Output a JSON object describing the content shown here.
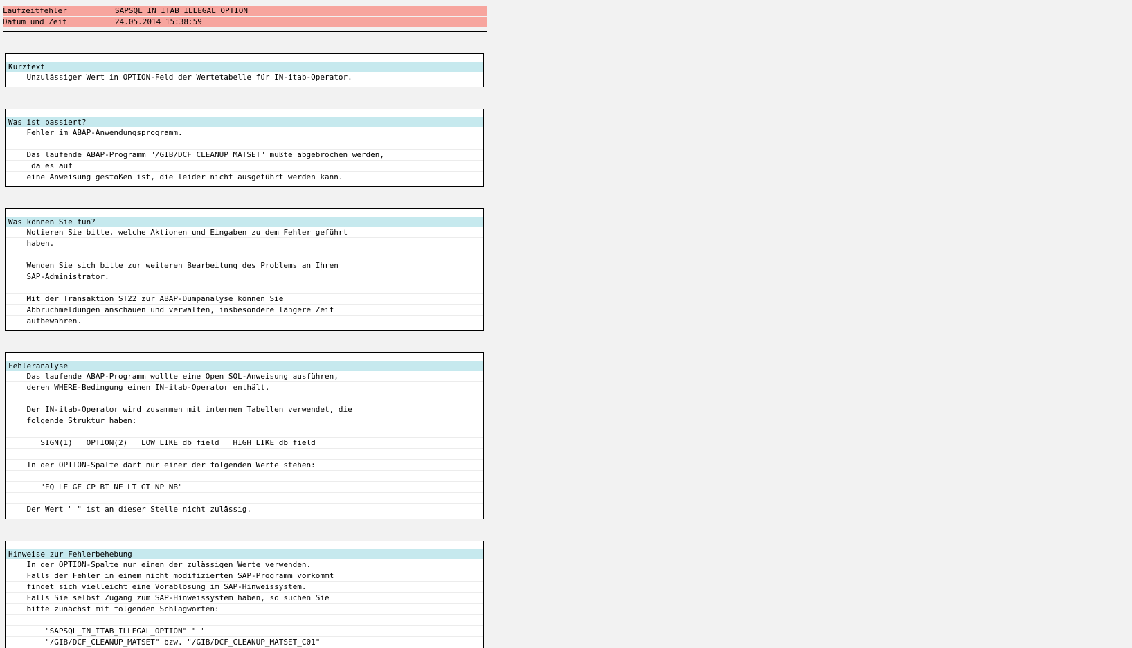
{
  "header": {
    "rows": [
      {
        "label": "Laufzeitfehler",
        "value": "SAPSQL_IN_ITAB_ILLEGAL_OPTION"
      },
      {
        "label": "Datum und Zeit",
        "value": "24.05.2014 15:38:59"
      }
    ]
  },
  "sections": [
    {
      "title": "Kurztext",
      "lines": [
        "    Unzulässiger Wert in OPTION-Feld der Wertetabelle für IN-itab-Operator."
      ]
    },
    {
      "title": "Was ist passiert?",
      "lines": [
        "    Fehler im ABAP-Anwendungsprogramm.",
        "",
        "    Das laufende ABAP-Programm \"/GIB/DCF_CLEANUP_MATSET\" mußte abgebrochen werden,",
        "     da es auf",
        "    eine Anweisung gestoßen ist, die leider nicht ausgeführt werden kann."
      ]
    },
    {
      "title": "Was können Sie tun?",
      "lines": [
        "    Notieren Sie bitte, welche Aktionen und Eingaben zu dem Fehler geführt",
        "    haben.",
        "",
        "    Wenden Sie sich bitte zur weiteren Bearbeitung des Problems an Ihren",
        "    SAP-Administrator.",
        "",
        "    Mit der Transaktion ST22 zur ABAP-Dumpanalyse können Sie",
        "    Abbruchmeldungen anschauen und verwalten, insbesondere längere Zeit",
        "    aufbewahren."
      ]
    },
    {
      "title": "Fehleranalyse",
      "lines": [
        "    Das laufende ABAP-Programm wollte eine Open SQL-Anweisung ausführen,",
        "    deren WHERE-Bedingung einen IN-itab-Operator enthält.",
        "",
        "    Der IN-itab-Operator wird zusammen mit internen Tabellen verwendet, die",
        "    folgende Struktur haben:",
        "",
        "       SIGN(1)   OPTION(2)   LOW LIKE db_field   HIGH LIKE db_field",
        "",
        "    In der OPTION-Spalte darf nur einer der folgenden Werte stehen:",
        "",
        "       \"EQ LE GE CP BT NE LT GT NP NB\"",
        "",
        "    Der Wert \" \" ist an dieser Stelle nicht zulässig."
      ]
    },
    {
      "title": "Hinweise zur Fehlerbehebung",
      "lines": [
        "    In der OPTION-Spalte nur einen der zulässigen Werte verwenden.",
        "    Falls der Fehler in einem nicht modifizierten SAP-Programm vorkommt",
        "    findet sich vielleicht eine Vorablösung im SAP-Hinweissystem.",
        "    Falls Sie selbst Zugang zum SAP-Hinweissystem haben, so suchen Sie",
        "    bitte zunächst mit folgenden Schlagworten:",
        "",
        "        \"SAPSQL_IN_ITAB_ILLEGAL_OPTION\" \" \"",
        "        \"/GIB/DCF_CLEANUP_MATSET\" bzw. \"/GIB/DCF_CLEANUP_MATSET_C01\""
      ]
    }
  ]
}
